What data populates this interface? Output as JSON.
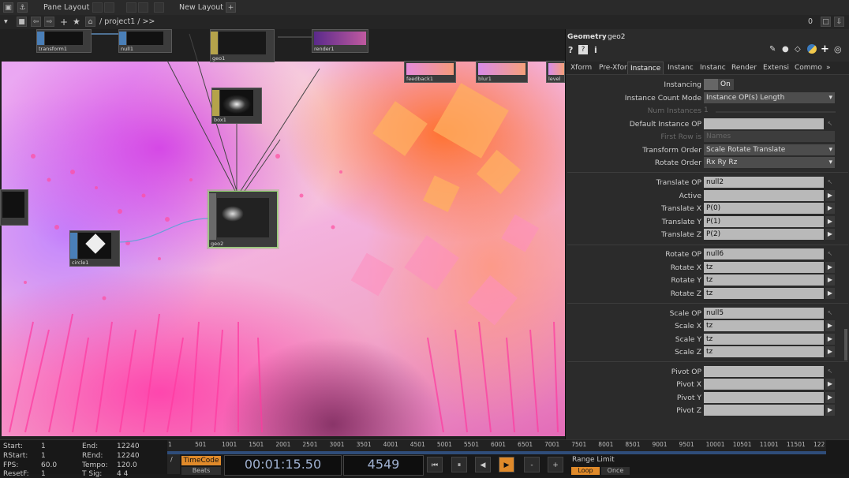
{
  "topbar": {
    "pane_layout_label": "Pane Layout",
    "new_layout_label": "New Layout",
    "plus": "+"
  },
  "pathbar": {
    "path": "/ project1 / >>",
    "right_counter": "0"
  },
  "nodes": {
    "transform": "transform1",
    "null1": "null1",
    "geo1": "geo1",
    "render1": "render1",
    "feedback1": "feedback1",
    "blur1": "blur1",
    "level": "level",
    "box1": "box1",
    "geo2": "geo2",
    "circle": "circle1"
  },
  "panel": {
    "type_label": "Geometry",
    "op_name": "geo2",
    "tabs": [
      "Xform",
      "Pre-Xfor",
      "Instance",
      "Instanc",
      "Instanc",
      "Render",
      "Extensi",
      "Commo"
    ],
    "tabs_more": "»",
    "params": {
      "instancing": {
        "label": "Instancing",
        "value": "On"
      },
      "count_mode": {
        "label": "Instance Count Mode",
        "value": "Instance OP(s) Length"
      },
      "num_instances": {
        "label": "Num Instances",
        "value": "1"
      },
      "default_op": {
        "label": "Default Instance OP",
        "value": ""
      },
      "first_row": {
        "label": "First Row is",
        "value": "Names"
      },
      "transform_order": {
        "label": "Transform Order",
        "value": "Scale Rotate Translate"
      },
      "rotate_order": {
        "label": "Rotate Order",
        "value": "Rx Ry Rz"
      },
      "translate_op": {
        "label": "Translate OP",
        "value": "null2"
      },
      "active": {
        "label": "Active",
        "value": ""
      },
      "tx": {
        "label": "Translate X",
        "value": "P(0)"
      },
      "ty": {
        "label": "Translate Y",
        "value": "P(1)"
      },
      "tz": {
        "label": "Translate Z",
        "value": "P(2)"
      },
      "rotate_op": {
        "label": "Rotate OP",
        "value": "null6"
      },
      "rx": {
        "label": "Rotate X",
        "value": "tz"
      },
      "ry": {
        "label": "Rotate Y",
        "value": "tz"
      },
      "rz": {
        "label": "Rotate Z",
        "value": "tz"
      },
      "scale_op": {
        "label": "Scale OP",
        "value": "null5"
      },
      "sx": {
        "label": "Scale X",
        "value": "tz"
      },
      "sy": {
        "label": "Scale Y",
        "value": "tz"
      },
      "sz": {
        "label": "Scale Z",
        "value": "tz"
      },
      "pivot_op": {
        "label": "Pivot OP",
        "value": ""
      },
      "px": {
        "label": "Pivot X",
        "value": ""
      },
      "py": {
        "label": "Pivot Y",
        "value": ""
      },
      "pz": {
        "label": "Pivot Z",
        "value": ""
      }
    }
  },
  "bottom": {
    "start_label": "Start:",
    "start_value": "1",
    "rstart_label": "RStart:",
    "rstart_value": "1",
    "fps_label": "FPS:",
    "fps_value": "60.0",
    "resetf_label": "ResetF:",
    "resetf_value": "1",
    "end_label": "End:",
    "end_value": "12240",
    "rend_label": "REnd:",
    "rend_value": "12240",
    "tempo_label": "Tempo:",
    "tempo_value": "120.0",
    "tsig_label": "T Sig:",
    "tsig_value": "4 4",
    "ruler_ticks": [
      "1",
      "501",
      "1001",
      "1501",
      "2001",
      "2501",
      "3001",
      "3501",
      "4001",
      "4501",
      "5001",
      "5501",
      "6001",
      "6501",
      "7001",
      "7501",
      "8001",
      "8501",
      "9001",
      "9501",
      "10001",
      "10501",
      "11001",
      "11501",
      "122"
    ],
    "timecode_label": "TimeCode",
    "beats_label": "Beats",
    "timecode_value": "00:01:15.50",
    "frame_value": "4549",
    "range_limit_label": "Range Limit",
    "loop_label": "Loop",
    "once_label": "Once"
  }
}
